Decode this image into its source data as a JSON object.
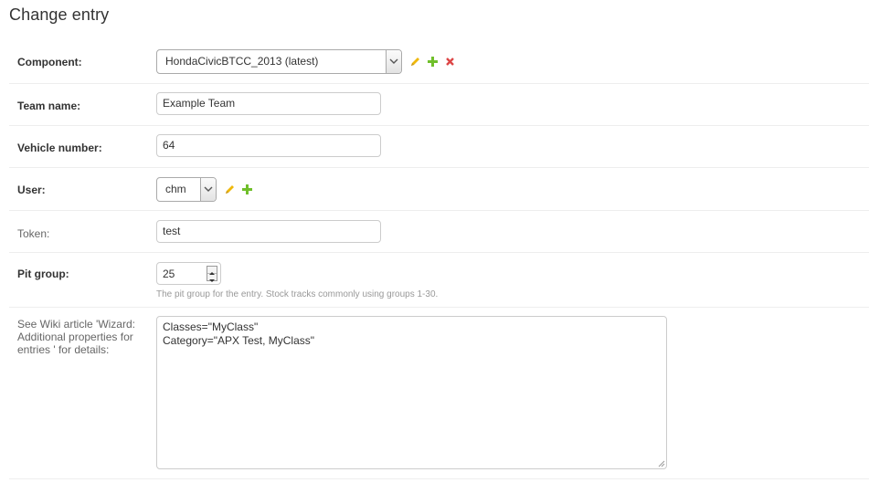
{
  "page": {
    "title": "Change entry"
  },
  "fields": {
    "component": {
      "label": "Component:",
      "value": "HondaCivicBTCC_2013 (latest)"
    },
    "team_name": {
      "label": "Team name:",
      "value": "Example Team"
    },
    "vehicle_number": {
      "label": "Vehicle number:",
      "value": "64"
    },
    "user": {
      "label": "User:",
      "value": "chm"
    },
    "token": {
      "label": "Token:",
      "value": "test"
    },
    "pit_group": {
      "label": "Pit group:",
      "value": "25",
      "help": "The pit group for the entry. Stock tracks commonly using groups 1-30."
    },
    "additional_properties": {
      "label": "See Wiki article 'Wizard: Additional properties for entries ' for details:",
      "value": "Classes=\"MyClass\"\nCategory=\"APX Test, MyClass\""
    }
  },
  "colors": {
    "change_icon": "#efb80b",
    "add_icon": "#70bf2b",
    "delete_icon": "#dd4646"
  },
  "icons": {
    "change": "pencil-icon",
    "add": "plus-icon",
    "delete": "delete-x-icon",
    "dropdown": "chevron-down-icon"
  }
}
